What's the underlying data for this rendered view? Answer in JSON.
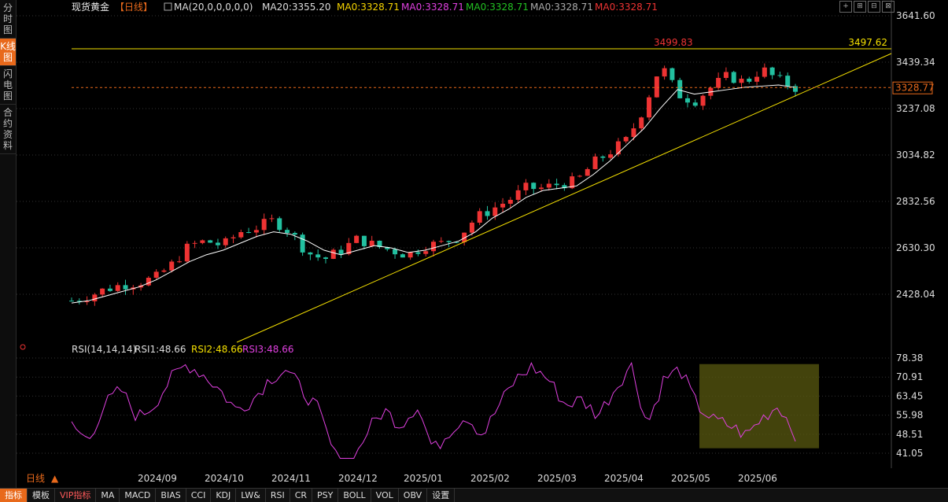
{
  "sidebar": {
    "tabs": [
      {
        "label": "分时图",
        "active": false
      },
      {
        "label": "K线图",
        "active": true
      },
      {
        "label": "闪电图",
        "active": false
      },
      {
        "label": "合约资料",
        "active": false
      }
    ]
  },
  "header": {
    "instrument": "现货黄金",
    "period": "【日线】",
    "ma_params": "MA(20,0,0,0,0,0)",
    "ma20": "MA20:3355.20",
    "ma0_items": [
      {
        "text": "MA0:3328.71",
        "color": "#f5d300"
      },
      {
        "text": "MA0:3328.71",
        "color": "#e040e0"
      },
      {
        "text": "MA0:3328.71",
        "color": "#22c022"
      },
      {
        "text": "MA0:3328.71",
        "color": "#aaaaaa"
      },
      {
        "text": "MA0:3328.71",
        "color": "#ee3333"
      }
    ]
  },
  "window_buttons": [
    "+",
    "⊞",
    "⊟",
    "⊠"
  ],
  "chart_data": [
    {
      "type": "candlestick",
      "y_ticks": [
        "3641.60",
        "3439.34",
        "3237.08",
        "3034.82",
        "2832.56",
        "2630.30",
        "2428.04"
      ],
      "ylim": [
        2428.04,
        3641.6
      ],
      "x_labels": [
        "2024/09",
        "2024/10",
        "2024/11",
        "2024/12",
        "2025/01",
        "2025/02",
        "2025/03",
        "2025/04",
        "2025/05",
        "2025/06"
      ],
      "high_label": "3499.83",
      "hline_label": "3497.62",
      "current_price": "3328.77",
      "ma20_series": [
        2390,
        2400,
        2420,
        2440,
        2460,
        2490,
        2530,
        2570,
        2600,
        2620,
        2650,
        2680,
        2700,
        2690,
        2660,
        2620,
        2600,
        2620,
        2640,
        2630,
        2610,
        2620,
        2640,
        2660,
        2700,
        2760,
        2800,
        2850,
        2880,
        2890,
        2900,
        2950,
        3010,
        3080,
        3150,
        3240,
        3320,
        3300,
        3310,
        3320,
        3330,
        3335,
        3340,
        3329
      ],
      "closes": [
        2400,
        2420,
        2450,
        2470,
        2480,
        2500,
        2560,
        2640,
        2660,
        2640,
        2700,
        2720,
        2750,
        2700,
        2610,
        2580,
        2620,
        2670,
        2640,
        2620,
        2600,
        2640,
        2650,
        2680,
        2760,
        2800,
        2840,
        2890,
        2890,
        2910,
        2920,
        3000,
        3050,
        3100,
        3240,
        3430,
        3300,
        3270,
        3330,
        3380,
        3350,
        3410,
        3360,
        3329
      ],
      "rsi": {
        "label": "RSI(14,14,14)",
        "rsi1": "RSI1:48.66",
        "rsi2": "RSI2:48.66",
        "rsi3": "RSI3:48.66",
        "y_ticks": [
          "78.38",
          "70.91",
          "63.45",
          "55.98",
          "48.51",
          "41.05"
        ],
        "ylim": [
          41.05,
          78.38
        ],
        "values": [
          52,
          46,
          60,
          66,
          55,
          60,
          70,
          76,
          72,
          66,
          58,
          62,
          70,
          74,
          66,
          58,
          40,
          36,
          50,
          58,
          52,
          60,
          42,
          50,
          56,
          48,
          60,
          70,
          75,
          70,
          60,
          62,
          56,
          66,
          76,
          52,
          70,
          74,
          60,
          54,
          52,
          48,
          55,
          60,
          48.66
        ]
      }
    }
  ],
  "bottom_toolbar": {
    "period_label": "日线",
    "items": [
      {
        "label": "指标",
        "active": true
      },
      {
        "label": "模板",
        "active": false
      },
      {
        "label": "VIP指标",
        "vip": true
      },
      {
        "label": "MA"
      },
      {
        "label": "MACD"
      },
      {
        "label": "BIAS"
      },
      {
        "label": "CCI"
      },
      {
        "label": "KDJ"
      },
      {
        "label": "LW&"
      },
      {
        "label": "RSI"
      },
      {
        "label": "CR"
      },
      {
        "label": "PSY"
      },
      {
        "label": "BOLL"
      },
      {
        "label": "VOL"
      },
      {
        "label": "OBV"
      },
      {
        "label": "设置"
      }
    ]
  },
  "colors": {
    "up": "#ee3333",
    "down": "#22c0a0",
    "ma": "#ffffff",
    "trend": "#f5e000",
    "accent": "#e8691b",
    "rsi": "#e040e0",
    "grid": "#333333"
  }
}
